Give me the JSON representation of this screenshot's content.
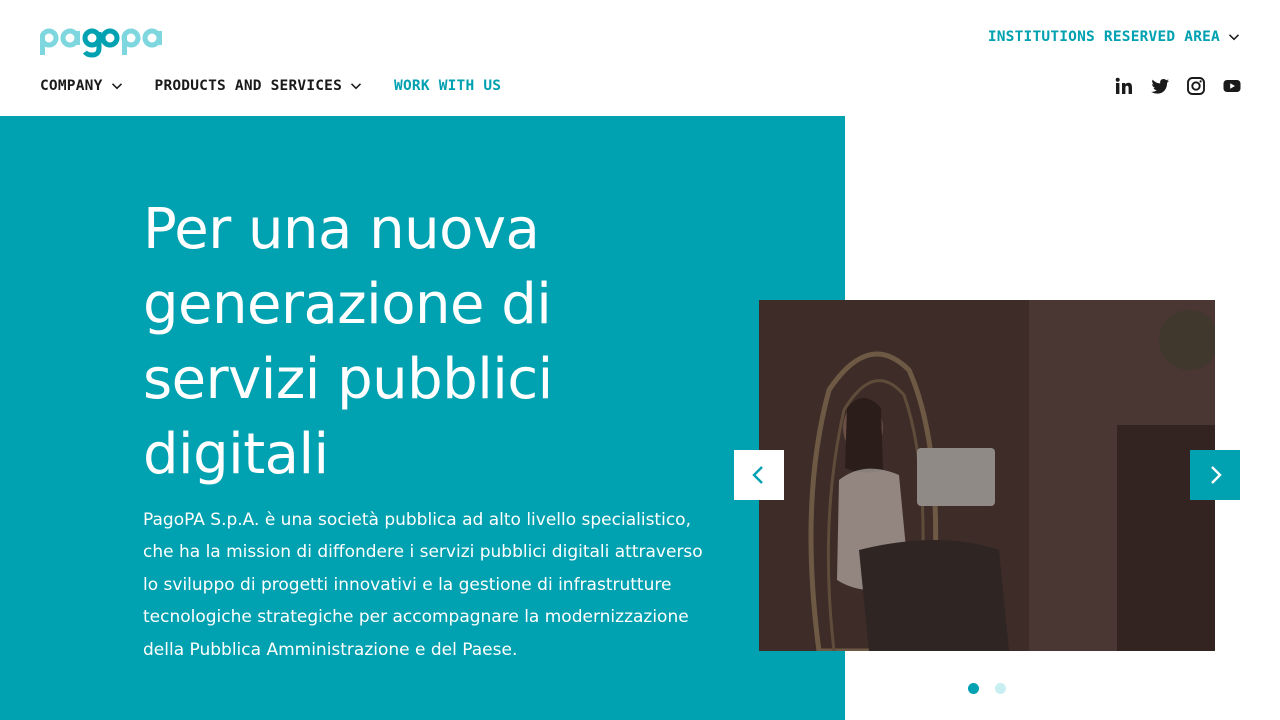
{
  "brand": {
    "logo_name": "pagoPA",
    "accent_color": "#00a1b0",
    "accent_light": "#7ed6de"
  },
  "header": {
    "reserved_area_label": "INSTITUTIONS RESERVED AREA",
    "nav": [
      {
        "label": "COMPANY",
        "has_dropdown": true
      },
      {
        "label": "PRODUCTS AND SERVICES",
        "has_dropdown": true
      },
      {
        "label": "WORK WITH US",
        "has_dropdown": false
      }
    ],
    "social": [
      "linkedin-icon",
      "twitter-icon",
      "instagram-icon",
      "youtube-icon"
    ]
  },
  "hero": {
    "title": "Per una nuova generazione di servizi pubblici digitali",
    "text": "PagoPA S.p.A. è una società pubblica ad alto livello specialistico, che ha la mission di diffondere i servizi pubblici digitali attraverso lo sviluppo di progetti innovativi e la gestione di infrastrutture tecnologiche strategiche per accompagnare la modernizzazione della Pubblica Amministrazione e del Paese.",
    "background_color": "#00a1b0"
  },
  "carousel": {
    "slide_count": 2,
    "active_index": 0,
    "slide_image": "woman-on-phone-in-hanging-chair-with-laptop"
  }
}
